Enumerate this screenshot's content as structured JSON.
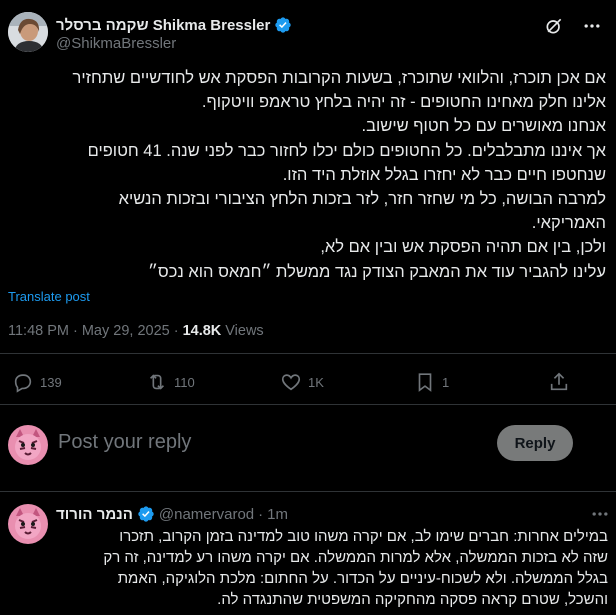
{
  "post": {
    "author": {
      "name": "שקמה ברסלר Shikma Bressler",
      "handle": "@ShikmaBressler"
    },
    "body_lines": [
      "אם אכן תוכרז, והלוואי שתוכרז, בשעות הקרובות הפסקת אש לחודשיים שתחזיר",
      "אלינו חלק מאחינו החטופים - זה יהיה בלחץ טראמפ וויטקוף.",
      "אנחנו מאושרים עם כל חטוף שישוב.",
      "אך איננו מתבלבלים. כל החטופים כולם יכלו לחזור כבר לפני שנה. 41 חטופים",
      "שנחטפו חיים כבר לא יחזרו בגלל אוזלת היד הזו.",
      "למרבה הבושה, כל מי שחזר חזר, לזר בזכות הלחץ הציבורי ובזכות הנשיא",
      "האמריקאי.",
      "ולכן, בין אם תהיה הפסקת אש ובין אם לא,",
      "עלינו להגביר עוד את המאבק הצודק נגד ממשלת ״חמאס הוא נכס״"
    ],
    "translate_label": "Translate post",
    "time": "11:48 PM",
    "date": "May 29, 2025",
    "views_count": "14.8K",
    "views_label": "Views",
    "separator": "·"
  },
  "actions": {
    "replies": "139",
    "reposts": "110",
    "likes": "1K",
    "bookmarks": "1"
  },
  "reply_box": {
    "placeholder": "Post your reply",
    "button_label": "Reply"
  },
  "reply_tweet": {
    "name": "הנמר הורוד",
    "handle": "@namervarod",
    "separator": "·",
    "time": "1m",
    "body_lines": [
      "במילים אחרות: חברים שימו לב, אם יקרה משהו טוב למדינה בזמן הקרוב, תזכרו",
      "שזה לא בזכות הממשלה, אלא למרות הממשלה. אם יקרה משהו רע למדינה, זה רק",
      "בגלל הממשלה. ולא לשכוח-עיניים על הכדור. על החתום: מלכת הלוגיקה, האמת",
      "והשכל, שטרם קראה פסקה מהחקיקה המשפטית שהתנגדה לה."
    ]
  },
  "colors": {
    "background": "#000000",
    "text": "#e7e9ea",
    "muted": "#71767b",
    "link": "#1d9bf0",
    "divider": "#2f3336",
    "verified": "#1d9bf0",
    "reply_button": "#787a7a"
  }
}
